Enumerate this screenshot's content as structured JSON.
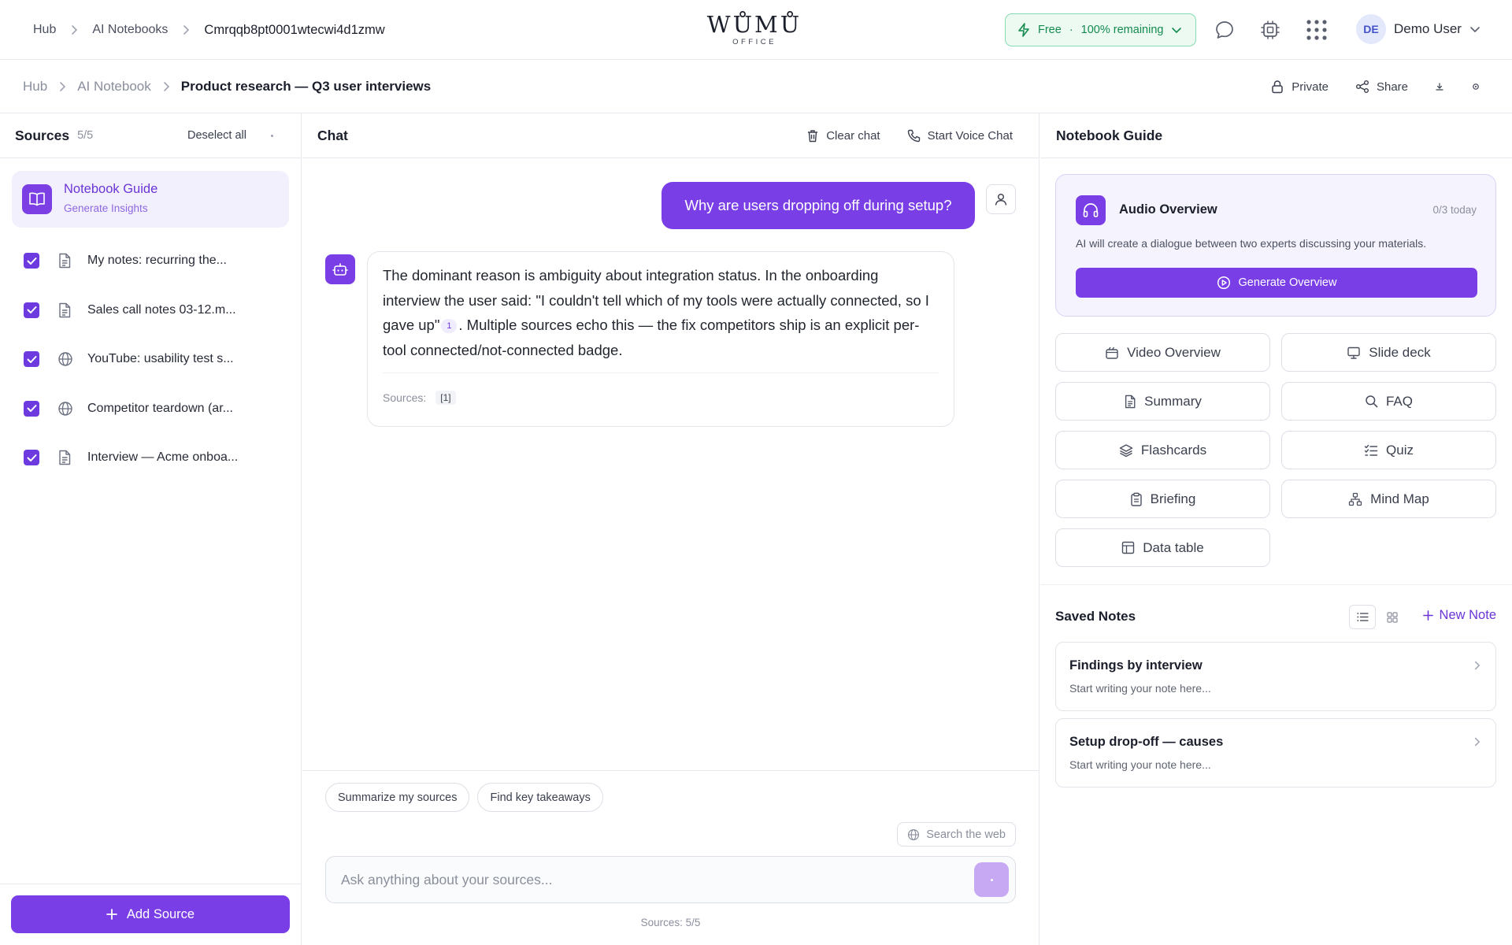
{
  "top": {
    "breadcrumbs": [
      "Hub",
      "AI Notebooks",
      "Cmrqqb8pt0001wtecwi4d1zmw"
    ],
    "logo": "WŮMŮ",
    "logo_sub": "OFFICE",
    "plan": {
      "name": "Free",
      "separator": "·",
      "remaining": "100% remaining"
    },
    "user": {
      "initials": "DE",
      "name": "Demo User"
    }
  },
  "subbar": {
    "breadcrumbs": [
      "Hub",
      "AI Notebook",
      "Product research — Q3 user interviews"
    ],
    "private_label": "Private",
    "share_label": "Share"
  },
  "sources": {
    "title": "Sources",
    "count": "5/5",
    "deselect_label": "Deselect all",
    "guide": {
      "title": "Notebook Guide",
      "subtitle": "Generate Insights"
    },
    "items": [
      {
        "name": "My notes: recurring the...",
        "icon": "document-icon"
      },
      {
        "name": "Sales call notes 03-12.m...",
        "icon": "document-icon"
      },
      {
        "name": "YouTube: usability test s...",
        "icon": "globe-icon"
      },
      {
        "name": "Competitor teardown (ar...",
        "icon": "globe-icon"
      },
      {
        "name": "Interview — Acme onboa...",
        "icon": "document-icon"
      }
    ],
    "add_label": "Add Source"
  },
  "chat": {
    "title": "Chat",
    "clear_label": "Clear chat",
    "voice_label": "Start Voice Chat",
    "user_message": "Why are users dropping off during setup?",
    "bot_message_part1": "The dominant reason is ambiguity about integration status. In the onboarding interview the user said: \"I couldn't tell which of my tools were actually connected, so I gave up\"",
    "bot_citation": "1",
    "bot_message_part2": ". Multiple sources echo this — the fix competitors ship is an explicit per-tool connected/not-connected badge.",
    "bot_sources_label": "Sources:",
    "bot_sources_ref": "[1]",
    "chips": [
      "Summarize my sources",
      "Find key takeaways"
    ],
    "search_web_label": "Search the web",
    "input_placeholder": "Ask anything about your sources...",
    "footer_sources": "Sources: 5/5"
  },
  "guide": {
    "title": "Notebook Guide",
    "audio": {
      "title": "Audio Overview",
      "quota": "0/3 today",
      "description": "AI will create a dialogue between two experts discussing your materials.",
      "button": "Generate Overview"
    },
    "tools": [
      {
        "label": "Video Overview",
        "icon": "video-icon"
      },
      {
        "label": "Slide deck",
        "icon": "presentation-icon"
      },
      {
        "label": "Summary",
        "icon": "document-icon"
      },
      {
        "label": "FAQ",
        "icon": "search-icon"
      },
      {
        "label": "Flashcards",
        "icon": "layers-icon"
      },
      {
        "label": "Quiz",
        "icon": "checklist-icon"
      },
      {
        "label": "Briefing",
        "icon": "clipboard-icon"
      },
      {
        "label": "Mind Map",
        "icon": "mindmap-icon"
      },
      {
        "label": "Data table",
        "icon": "table-icon"
      }
    ],
    "saved_notes_title": "Saved Notes",
    "new_note_label": "New Note",
    "notes": [
      {
        "title": "Findings by interview",
        "preview": "Start writing your note here..."
      },
      {
        "title": "Setup drop-off — causes",
        "preview": "Start writing your note here..."
      }
    ]
  },
  "colors": {
    "accent": "#7a3ee6",
    "accent_soft": "#f3f0fd",
    "plan_green": "#148a4f"
  }
}
